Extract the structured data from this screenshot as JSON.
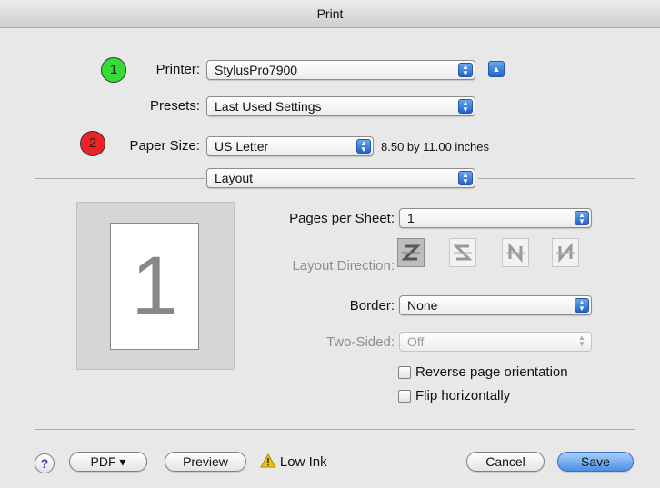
{
  "window": {
    "title": "Print"
  },
  "badges": {
    "printer": "1",
    "paper_size": "2"
  },
  "colors": {
    "badge1": "#33dd33",
    "badge2": "#ee2222",
    "accent": "#2f73d8",
    "warning": "#f2c200"
  },
  "printer": {
    "label": "Printer:",
    "value": "StylusPro7900"
  },
  "presets": {
    "label": "Presets:",
    "value": "Last Used Settings"
  },
  "paper_size": {
    "label": "Paper Size:",
    "value": "US Letter",
    "dimensions": "8.50 by 11.00 inches"
  },
  "section": {
    "value": "Layout"
  },
  "preview": {
    "page_number": "1"
  },
  "pages_per_sheet": {
    "label": "Pages per Sheet:",
    "value": "1"
  },
  "layout_direction": {
    "label": "Layout Direction:",
    "options": [
      "z-order-icon",
      "reverse-z-order-icon",
      "n-order-icon",
      "reverse-n-order-icon"
    ]
  },
  "border": {
    "label": "Border:",
    "value": "None"
  },
  "two_sided": {
    "label": "Two-Sided:",
    "value": "Off"
  },
  "options": {
    "reverse": "Reverse page orientation",
    "flip": "Flip horizontally"
  },
  "footer": {
    "help": "?",
    "pdf": "PDF ▾",
    "preview": "Preview",
    "warning": "Low Ink",
    "cancel": "Cancel",
    "save": "Save"
  }
}
